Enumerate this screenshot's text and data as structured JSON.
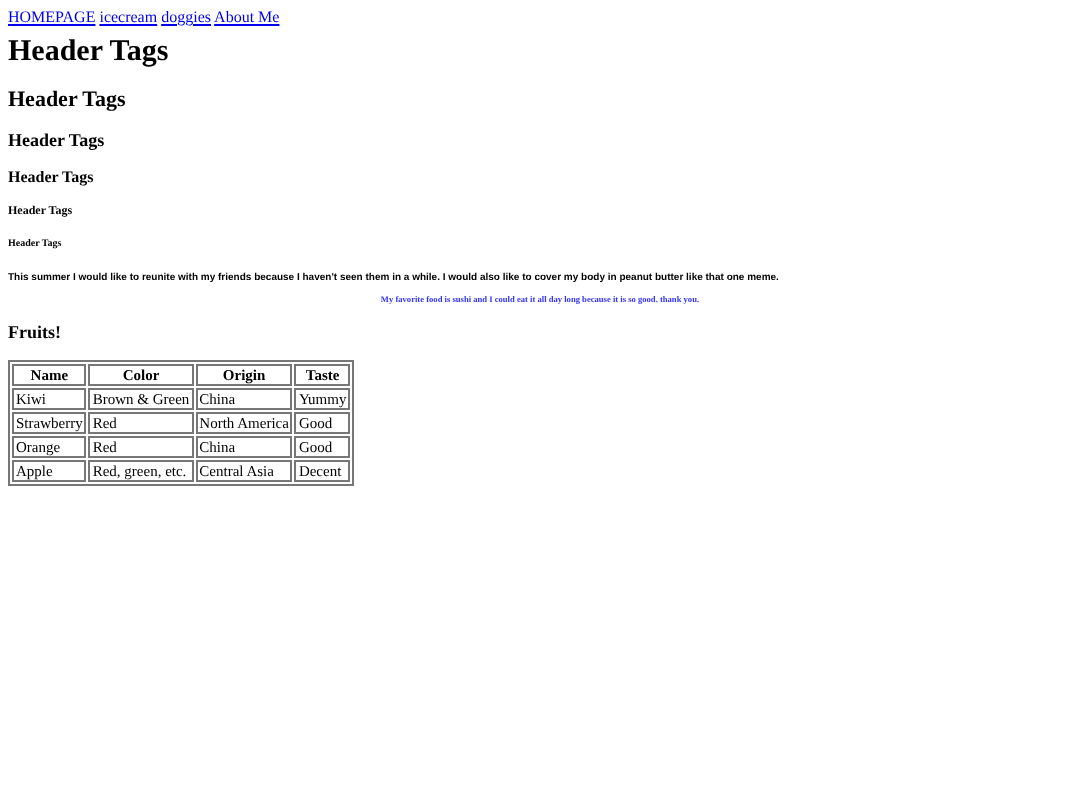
{
  "nav": [
    {
      "label": "HOMEPAGE"
    },
    {
      "label": "icecream"
    },
    {
      "label": "doggies"
    },
    {
      "label": "About Me"
    }
  ],
  "headings": [
    {
      "kind": "h1",
      "text": "Header Tags"
    },
    {
      "kind": "h2",
      "text": "Header Tags"
    },
    {
      "kind": "h3",
      "text": "Header Tags"
    },
    {
      "kind": "h4",
      "text": "Header Tags"
    },
    {
      "kind": "h5",
      "text": "Header Tags"
    },
    {
      "kind": "h6",
      "text": "Header Tags"
    }
  ],
  "paragraphs": [
    {
      "kind": "plain",
      "text": "This summer I would like to reunite with my friends because I haven't seen them in a while. I would also like to cover my body in peanut butter like that one meme."
    },
    {
      "kind": "highlight",
      "text": "My favorite food is sushi and I could eat it all day long because it is so good. thank you."
    }
  ],
  "fruits": {
    "title": "Fruits!",
    "columns": [
      "Name",
      "Color",
      "Origin",
      "Taste"
    ],
    "rows": [
      [
        "Kiwi",
        "Brown & Green",
        "China",
        "Yummy"
      ],
      [
        "Strawberry",
        "Red",
        "North America",
        "Good"
      ],
      [
        "Orange",
        "Red",
        "China",
        "Good"
      ],
      [
        "Apple",
        "Red, green, etc.",
        "Central Asia",
        "Decent"
      ]
    ]
  }
}
